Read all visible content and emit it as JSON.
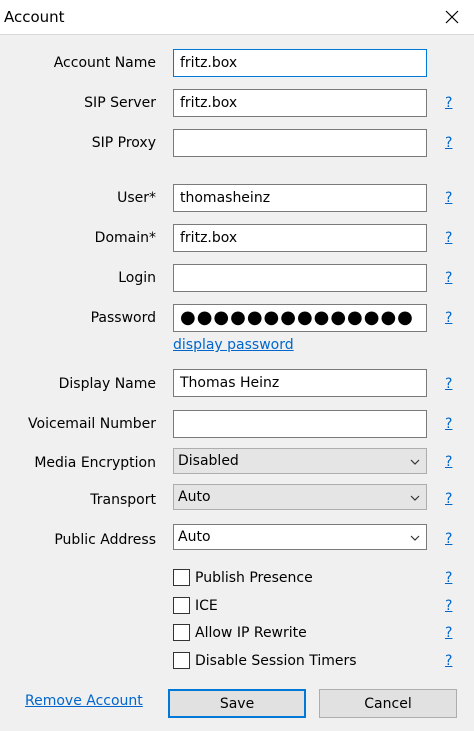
{
  "window": {
    "title": "Account"
  },
  "form": {
    "account_name": {
      "label": "Account Name",
      "value": "fritz.box"
    },
    "sip_server": {
      "label": "SIP Server",
      "value": "fritz.box"
    },
    "sip_proxy": {
      "label": "SIP Proxy",
      "value": ""
    },
    "user": {
      "label": "User",
      "required_mark": "*",
      "value": "thomasheinz"
    },
    "domain": {
      "label": "Domain",
      "required_mark": "*",
      "value": "fritz.box"
    },
    "login": {
      "label": "Login",
      "value": ""
    },
    "password": {
      "label": "Password",
      "value": "●●●●●●●●●●●●●●",
      "show_link": "display password"
    },
    "display_name": {
      "label": "Display Name",
      "value": "Thomas Heinz"
    },
    "voicemail_number": {
      "label": "Voicemail Number",
      "value": ""
    },
    "media_encryption": {
      "label": "Media Encryption",
      "value": "Disabled"
    },
    "transport": {
      "label": "Transport",
      "value": "Auto"
    },
    "public_address": {
      "label": "Public Address",
      "value": "Auto"
    },
    "help_text": "?"
  },
  "checkboxes": [
    {
      "label": "Publish Presence",
      "checked": false
    },
    {
      "label": "ICE",
      "checked": false
    },
    {
      "label": "Allow IP Rewrite",
      "checked": false
    },
    {
      "label": "Disable Session Timers",
      "checked": false
    }
  ],
  "footer": {
    "remove_account": "Remove Account",
    "save": "Save",
    "cancel": "Cancel"
  },
  "colors": {
    "link": "#0066cc",
    "focus": "#0078d7",
    "dialog_bg": "#f0f0f0"
  },
  "icons": {
    "close": "close-icon",
    "dropdown": "chevron-down-icon"
  }
}
